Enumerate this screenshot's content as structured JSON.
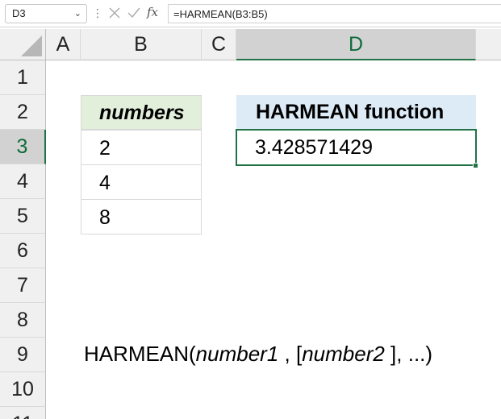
{
  "formula_bar": {
    "name_box": "D3",
    "formula": "=HARMEAN(B3:B5)",
    "icons": [
      "cancel-icon",
      "enter-icon",
      "function-icon"
    ],
    "fx_label": "fx"
  },
  "columns": [
    "A",
    "B",
    "C",
    "D"
  ],
  "rows": [
    "1",
    "2",
    "3",
    "4",
    "5",
    "6",
    "7",
    "8",
    "9",
    "10",
    "11"
  ],
  "selected": {
    "column": "D",
    "row": "3"
  },
  "table": {
    "header": "numbers",
    "values": [
      "2",
      "4",
      "8"
    ]
  },
  "result": {
    "header": "HARMEAN function",
    "value": "3.428571429"
  },
  "syntax": {
    "func": "HARMEAN(",
    "arg1": "number1",
    "sep1": " , [",
    "arg2": "number2",
    "tail": " ], ...)"
  },
  "colors": {
    "selection_green": "#217346",
    "table_header_fill": "#e2efda",
    "result_header_fill": "#ddebf7"
  }
}
